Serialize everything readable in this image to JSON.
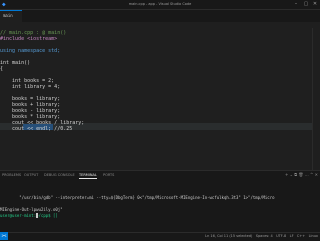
{
  "window": {
    "title": "main.cpp - app - Visual Studio Code",
    "app_icon": "vscode-icon"
  },
  "editor": {
    "tab_label": "main",
    "breadcrumb": "",
    "lines": [
      {
        "text": "// main.cpp : @ main()",
        "cls": "cl-comment"
      },
      {
        "text": "#include <iostream>",
        "cls": "cl-include"
      },
      {
        "text": "",
        "cls": "cl-plain"
      },
      {
        "text": "using namespace std;",
        "cls": "cl-kw"
      },
      {
        "text": "",
        "cls": "cl-plain"
      },
      {
        "text": "int main()",
        "cls": "cl-plain"
      },
      {
        "text": "{",
        "cls": "cl-plain"
      },
      {
        "text": "",
        "cls": "cl-plain"
      },
      {
        "text": "    int books = 2;",
        "cls": "cl-plain"
      },
      {
        "text": "    int library = 4;",
        "cls": "cl-plain"
      },
      {
        "text": "",
        "cls": "cl-plain"
      },
      {
        "text": "    books = library;",
        "cls": "cl-plain"
      },
      {
        "text": "    books + library;",
        "cls": "cl-plain"
      },
      {
        "text": "    books - library;",
        "cls": "cl-plain"
      },
      {
        "text": "    books * library;",
        "cls": "cl-plain"
      },
      {
        "text": "    cout << books / library;",
        "cls": "cl-plain"
      },
      {
        "text": "    cout << endl; //0.25",
        "cls": "cl-plain"
      }
    ]
  },
  "panel": {
    "tabs": [
      "PROBLEMS",
      "OUTPUT",
      "DEBUG CONSOLE",
      "TERMINAL",
      "PORTS"
    ],
    "active_tab": "TERMINAL",
    "icons_text": "+ ⌄ ⧉ 🗑 … ^ ✕",
    "terminal_lines": [
      {
        "text": "",
        "cls": ""
      },
      {
        "text": "        \"/usr/bin/gdb\" --interpreter=mi --tty=${DbgTerm} 0<\"/tmp/Microsoft-MIEngine-In-wcfulkqh.3t3\" 1>\"/tmp/Micro",
        "cls": ""
      },
      {
        "text": "",
        "cls": ""
      },
      {
        "text": "MIEngine-Out-lpwu2ily.o0j\"",
        "cls": ""
      },
      {
        "text": "user@user-mint:~/cpp$ []",
        "cls": "term-prompt"
      }
    ]
  },
  "statusbar": {
    "right_text": "Ln 16, Col 11 (15 selected)   Spaces: 4   UTF-8   LF   C++   Linux"
  },
  "colors": {
    "accent": "#0078d4",
    "background": "#1f1f1f",
    "terminal_prompt": "#23d18b"
  }
}
